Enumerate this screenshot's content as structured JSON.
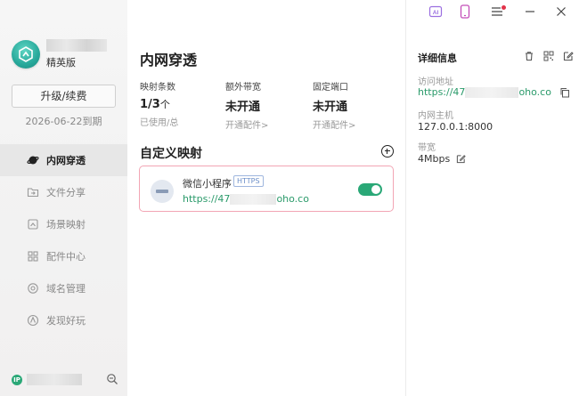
{
  "sidebar": {
    "edition": "精英版",
    "renew_button": "升级/续费",
    "expire_text": "2026-06-22到期",
    "nav": [
      {
        "label": "内网穿透",
        "icon": "planet-icon",
        "active": true
      },
      {
        "label": "文件分享",
        "icon": "folder-share-icon",
        "active": false
      },
      {
        "label": "场景映射",
        "icon": "scene-map-icon",
        "active": false
      },
      {
        "label": "配件中心",
        "icon": "grid-icon",
        "active": false
      },
      {
        "label": "域名管理",
        "icon": "domain-icon",
        "active": false
      },
      {
        "label": "发现好玩",
        "icon": "discover-icon",
        "active": false
      }
    ],
    "ip_badge": "IP"
  },
  "topbar": {
    "icons": [
      "ai-icon",
      "phone-icon",
      "menu-icon",
      "minimize-icon",
      "close-icon"
    ],
    "accent_ai": "#9b6fe0",
    "accent_phone": "#c44fb9"
  },
  "main": {
    "title": "内网穿透",
    "stats": [
      {
        "label": "映射条数",
        "value": "1/3",
        "unit": "个",
        "sub": "已使用/总"
      },
      {
        "label": "额外带宽",
        "value": "未开通",
        "unit": "",
        "sub": "开通配件>"
      },
      {
        "label": "固定端口",
        "value": "未开通",
        "unit": "",
        "sub": "开通配件>"
      }
    ],
    "section_title": "自定义映射",
    "mapping": {
      "name": "微信小程序",
      "protocol": "HTTPS",
      "url_prefix": "https://47",
      "url_suffix": "oho.co",
      "enabled": true
    }
  },
  "details": {
    "title": "详细信息",
    "access_label": "访问地址",
    "access_prefix": "https://47",
    "access_suffix": "oho.co",
    "host_label": "内网主机",
    "host_value": "127.0.0.1:8000",
    "bandwidth_label": "带宽",
    "bandwidth_value": "4Mbps"
  },
  "colors": {
    "accent_green": "#2aa877",
    "link_green": "#2a9a6a",
    "card_border": "#f2a5b4",
    "notify_dot": "#e2334a"
  }
}
